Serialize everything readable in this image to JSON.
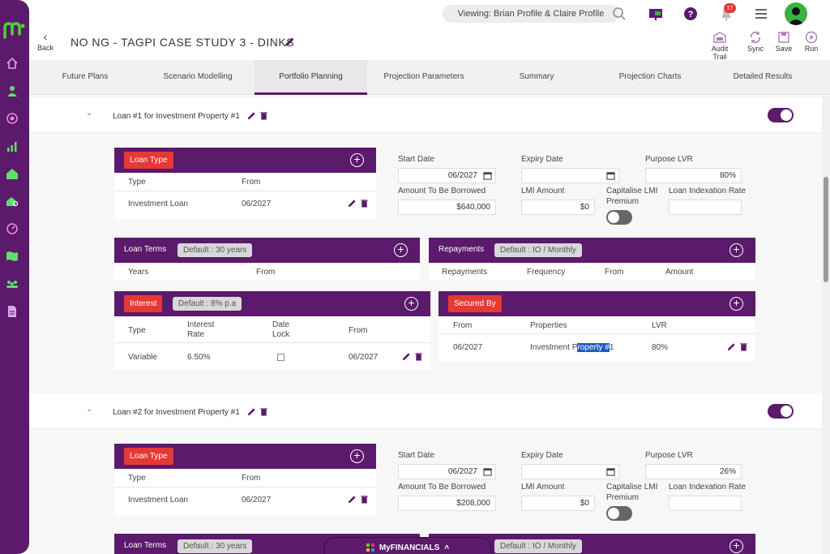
{
  "topbar": {
    "viewing": "Viewing: Brian Profile & Claire Profile",
    "notification_count": "17"
  },
  "title_row": {
    "back_label": "Back",
    "page_title": "NO NG - TAGPI CASE STUDY 3 - DINKS",
    "tools": [
      {
        "label": "Audit Trail",
        "icon": "audit-trail-icon"
      },
      {
        "label": "Sync",
        "icon": "sync-icon"
      },
      {
        "label": "Save",
        "icon": "save-icon"
      },
      {
        "label": "Run",
        "icon": "run-icon"
      }
    ]
  },
  "tabs": [
    {
      "label": "Future Plans"
    },
    {
      "label": "Scenario Modelling"
    },
    {
      "label": "Portfolio Planning",
      "active": true
    },
    {
      "label": "Projection Parameters"
    },
    {
      "label": "Summary"
    },
    {
      "label": "Projection Charts"
    },
    {
      "label": "Detailed Results"
    }
  ],
  "loans": [
    {
      "title": "Loan #1 for Investment Property #1",
      "loan_type": {
        "chip": "Loan Type",
        "columns": [
          "Type",
          "From"
        ],
        "rows": [
          {
            "type": "Investment Loan",
            "from": "06/2027"
          }
        ]
      },
      "fields": {
        "start_date_label": "Start Date",
        "start_date": "06/2027",
        "expiry_date_label": "Expiry Date",
        "expiry_date": "",
        "purpose_lvr_label": "Purpose LVR",
        "purpose_lvr": "80%",
        "amount_label": "Amount To Be Borrowed",
        "amount": "$640,000",
        "lmi_label": "LMI Amount",
        "lmi": "$0",
        "capitalise_label_1": "Capitalise LMI",
        "capitalise_label_2": "Premium",
        "indexation_label": "Loan Indexation Rate",
        "indexation": ""
      },
      "loan_terms": {
        "label": "Loan Terms",
        "default": "Default : 30 years",
        "columns": [
          "Years",
          "From"
        ]
      },
      "repayments": {
        "label": "Repayments",
        "default": "Default : IO / Monthly",
        "columns": [
          "Repayments",
          "Frequency",
          "From",
          "Amount"
        ]
      },
      "interest": {
        "chip": "Interest",
        "default": "Default : 8% p.a",
        "columns": [
          "Type",
          "Interest",
          "Rate",
          "Date",
          "Lock",
          "From"
        ],
        "rows": [
          {
            "type": "Variable",
            "rate": "6.50%",
            "from": "06/2027"
          }
        ]
      },
      "secured_by": {
        "chip": "Secured By",
        "columns": [
          "From",
          "Properties",
          "LVR"
        ],
        "rows": [
          {
            "from": "06/2027",
            "property_a": "Investment P",
            "property_b": "roperty #",
            "property_c": "1",
            "lvr": "80%"
          }
        ]
      }
    },
    {
      "title": "Loan #2 for Investment Property #1",
      "loan_type": {
        "chip": "Loan Type",
        "columns": [
          "Type",
          "From"
        ],
        "rows": [
          {
            "type": "Investment Loan",
            "from": "06/2027"
          }
        ]
      },
      "fields": {
        "start_date_label": "Start Date",
        "start_date": "06/2027",
        "expiry_date_label": "Expiry Date",
        "expiry_date": "",
        "purpose_lvr_label": "Purpose LVR",
        "purpose_lvr": "26%",
        "amount_label": "Amount To Be Borrowed",
        "amount": "$208,000",
        "lmi_label": "LMI Amount",
        "lmi": "$0",
        "capitalise_label_1": "Capitalise LMI",
        "capitalise_label_2": "Premium",
        "indexation_label": "Loan Indexation Rate",
        "indexation": ""
      },
      "loan_terms": {
        "label": "Loan Terms",
        "default": "Default : 30 years"
      },
      "repayments": {
        "default": "Default : IO / Monthly"
      }
    }
  ],
  "footer_bar": {
    "label": "MyFINANCIALS"
  },
  "colors": {
    "brand_purple": "#5b1a6b",
    "accent_red": "#e53935",
    "green": "#3cb043"
  }
}
